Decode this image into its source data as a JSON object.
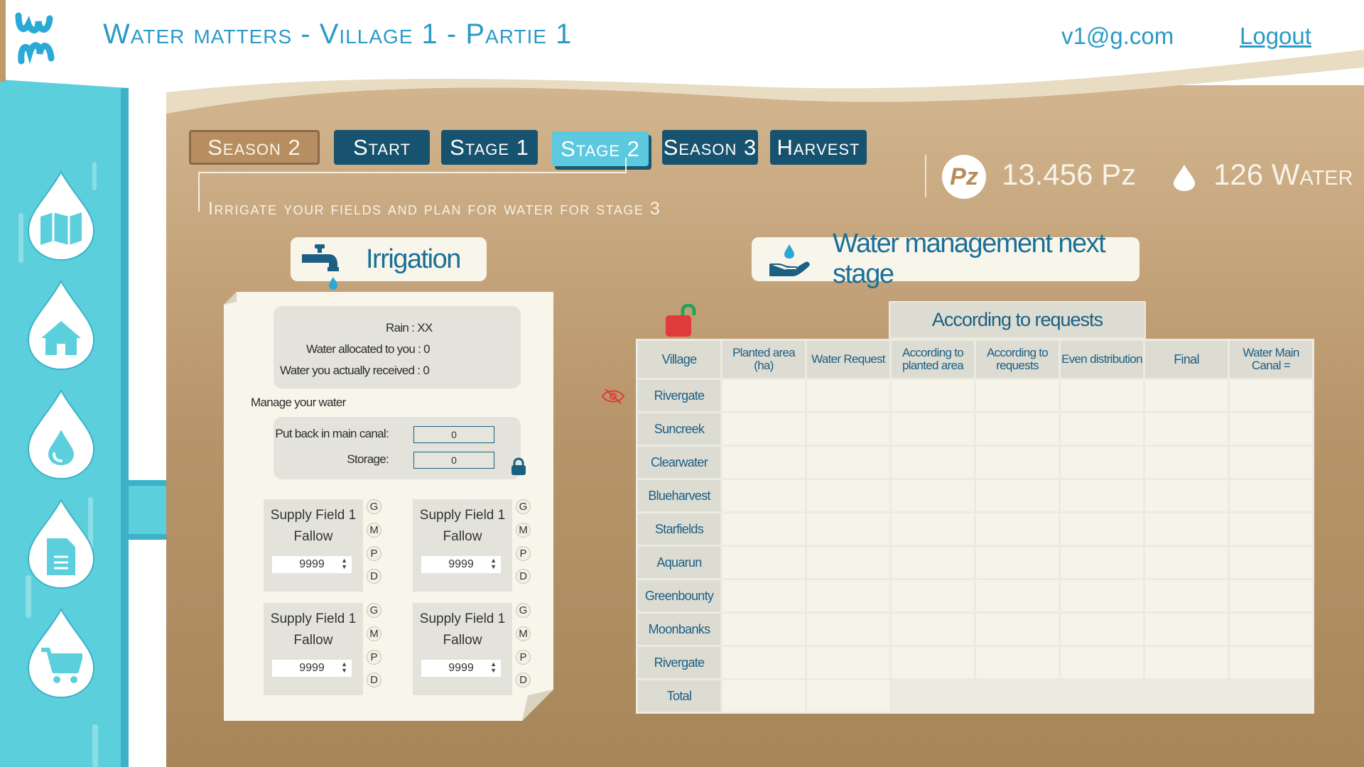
{
  "header": {
    "title": "Water matters - Village 1 - Partie 1",
    "user_email": "v1@g.com",
    "logout_label": "Logout"
  },
  "sidebar": {
    "items": [
      {
        "icon": "map-icon"
      },
      {
        "icon": "home-icon"
      },
      {
        "icon": "water-drop-icon"
      },
      {
        "icon": "document-icon"
      },
      {
        "icon": "cart-icon"
      }
    ]
  },
  "tabs": {
    "season_label": "Season 2",
    "items": [
      {
        "label": "Start",
        "active": false
      },
      {
        "label": "Stage 1",
        "active": false
      },
      {
        "label": "Stage 2",
        "active": true
      },
      {
        "label": "Season 3",
        "active": false
      },
      {
        "label": "Harvest",
        "active": false
      }
    ],
    "instruction": "Irrigate your fields and plan for water for stage 3"
  },
  "stats": {
    "pz_badge": "Pz",
    "pz_value": "13.456 Pz",
    "water_value": "126 Water"
  },
  "irrigation": {
    "title": "Irrigation",
    "rain": "Rain : XX",
    "water_allocated": "Water allocated to you : 0",
    "water_received": "Water you actually received : 0",
    "manage_label": "Manage your water",
    "put_back_label": "Put back in main canal:",
    "put_back_value": "0",
    "storage_label": "Storage:",
    "storage_value": "0",
    "fields": [
      {
        "name": "Supply Field 1",
        "state": "Fallow",
        "value": "9999",
        "options": [
          "G",
          "M",
          "P",
          "D"
        ]
      },
      {
        "name": "Supply Field 1",
        "state": "Fallow",
        "value": "9999",
        "options": [
          "G",
          "M",
          "P",
          "D"
        ]
      },
      {
        "name": "Supply Field 1",
        "state": "Fallow",
        "value": "9999",
        "options": [
          "G",
          "M",
          "P",
          "D"
        ]
      },
      {
        "name": "Supply Field 1",
        "state": "Fallow",
        "value": "9999",
        "options": [
          "G",
          "M",
          "P",
          "D"
        ]
      }
    ]
  },
  "water_management": {
    "title": "Water management next stage",
    "group_header": "According to requests",
    "columns": {
      "village": "Village",
      "planted_area": "Planted area (ha)",
      "water_request": "Water Request",
      "according_planted": "According to planted area",
      "according_requests": "According to requests",
      "even_distribution": "Even distribution",
      "final": "Final",
      "water_main_canal": "Water Main Canal ="
    },
    "villages": [
      "Rivergate",
      "Suncreek",
      "Clearwater",
      "Blueharvest",
      "Starfields",
      "Aquarun",
      "Greenbounty",
      "Moonbanks",
      "Rivergate"
    ],
    "total_label": "Total"
  },
  "colors": {
    "primary_blue": "#2a9bc6",
    "dark_blue": "#17536e",
    "active_tab": "#5cc9e0",
    "sand": "#b68e62",
    "sidebar": "#5ccfdd",
    "lock_red": "#e03a3a"
  }
}
